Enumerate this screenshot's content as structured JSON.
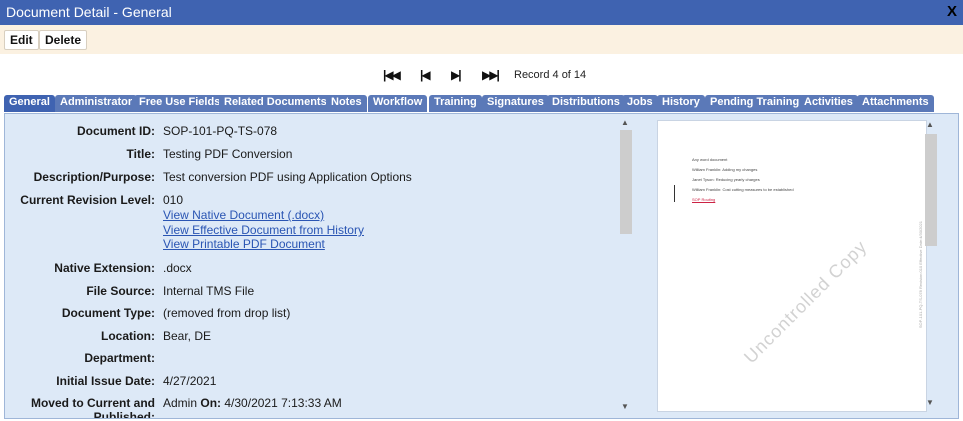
{
  "window": {
    "title": "Document Detail - General",
    "close_label": "X"
  },
  "actions": {
    "edit": "Edit",
    "delete": "Delete"
  },
  "pager": {
    "first": "⏮",
    "prev": "◀",
    "next": "▶",
    "last": "⏭",
    "record_text": "Record 4 of 14"
  },
  "tabs": [
    "General",
    "Administrator",
    "Free Use Fields",
    "Related Documents",
    "Notes",
    "Workflow",
    "Training",
    "Signatures",
    "Distributions",
    "Jobs",
    "History",
    "Pending Training",
    "Activities",
    "Attachments"
  ],
  "active_tab": "General",
  "fields": {
    "document_id": {
      "label": "Document ID:",
      "value": "SOP-101-PQ-TS-078"
    },
    "title": {
      "label": "Title:",
      "value": "Testing PDF Conversion"
    },
    "description": {
      "label": "Description/Purpose:",
      "value": "Test conversion PDF using Application Options"
    },
    "revision": {
      "label": "Current Revision Level:",
      "value": "010"
    },
    "native_ext": {
      "label": "Native Extension:",
      "value": ".docx"
    },
    "file_source": {
      "label": "File Source:",
      "value": "Internal TMS File"
    },
    "doc_type": {
      "label": "Document Type:",
      "value": "(removed from drop list)"
    },
    "location": {
      "label": "Location:",
      "value": "Bear, DE"
    },
    "department": {
      "label": "Department:",
      "value": ""
    },
    "issue_date": {
      "label": "Initial Issue Date:",
      "value": "4/27/2021"
    },
    "moved": {
      "label_line1": "Moved to Current and",
      "label_line2": "Published:",
      "user": "Admin",
      "on_label": "On:",
      "timestamp": "4/30/2021 7:13:33 AM"
    }
  },
  "links": {
    "native": "View Native Document (.docx)",
    "effective": "View Effective Document from History",
    "printable": "View Printable PDF Document"
  },
  "preview": {
    "lines": [
      "Any word document",
      "William Franklin: Adding my changes",
      "Janet Tyson: Reducing yearly charges",
      "William Franklin: Cost cutting measures to be established"
    ],
    "link_line": "SOP Routing",
    "watermark": "Uncontrolled Copy",
    "side_text": "SOP-101-PQ-TS-078   Revision:010   Effective Date:4/30/2021"
  },
  "icons": {
    "scroll_up": "scroll-up-arrow-icon",
    "scroll_down": "scroll-down-arrow-icon"
  },
  "colors": {
    "title_bar": "#3f63b1",
    "action_bar": "#fbf1e1",
    "panel": "#dde9f7",
    "tab": "#5b79b8",
    "link": "#2a55b3"
  }
}
